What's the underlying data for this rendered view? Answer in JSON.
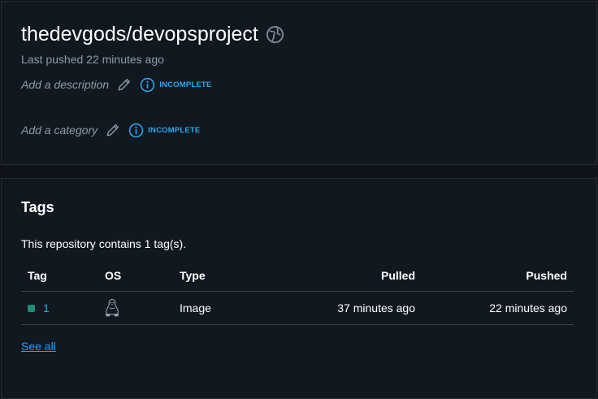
{
  "repo": {
    "name": "thedevgods/devopsproject",
    "last_pushed": "Last pushed 22 minutes ago",
    "description_placeholder": "Add a description",
    "category_placeholder": "Add a category",
    "status": "INCOMPLETE",
    "visibility_icon": "globe-icon"
  },
  "tags": {
    "heading": "Tags",
    "count_text": "This repository contains 1 tag(s).",
    "columns": {
      "tag": "Tag",
      "os": "OS",
      "type": "Type",
      "pulled": "Pulled",
      "pushed": "Pushed"
    },
    "rows": [
      {
        "tag": "1",
        "os_icon": "linux-icon",
        "type": "Image",
        "pulled": "37 minutes ago",
        "pushed": "22 minutes ago"
      }
    ],
    "see_all": "See all"
  },
  "colors": {
    "background": "#10141a",
    "card": "#111820",
    "muted_text": "#8c9bab",
    "accent": "#2aa7ef",
    "link": "#1f9dff",
    "tag_dot": "#1d8f77"
  }
}
